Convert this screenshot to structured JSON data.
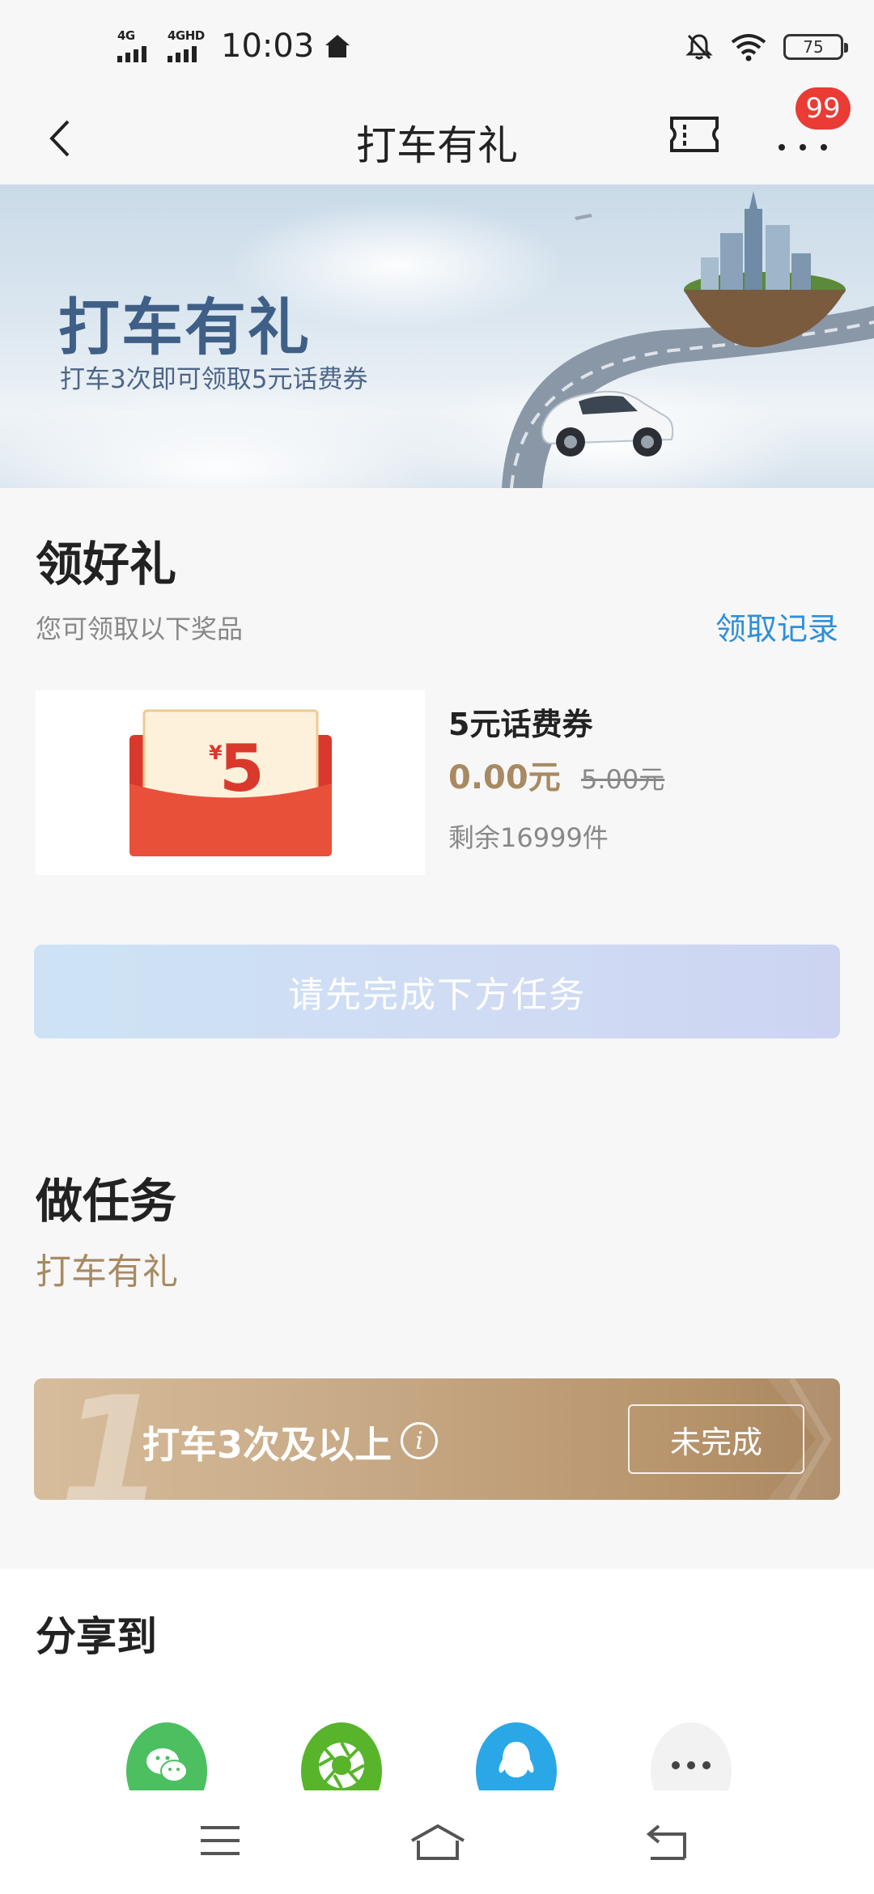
{
  "status_bar": {
    "net1": "4G",
    "net2": "4GHD",
    "time": "10:03",
    "battery": "75"
  },
  "nav": {
    "title": "打车有礼",
    "badge": "99"
  },
  "banner": {
    "title": "打车有礼",
    "subtitle": "打车3次即可领取5元话费券"
  },
  "gift": {
    "title": "领好礼",
    "subtitle": "您可领取以下奖品",
    "record_link": "领取记录",
    "prize": {
      "coupon_symbol": "¥",
      "coupon_value": "5",
      "name": "5元话费券",
      "price": "0.00元",
      "original_price": "5.00元",
      "remaining": "剩余16999件"
    },
    "claim_button": "请先完成下方任务"
  },
  "task": {
    "title": "做任务",
    "subtitle": "打车有礼",
    "item": {
      "number": "1",
      "label": "打车3次及以上",
      "info": "i",
      "status": "未完成"
    }
  },
  "share": {
    "title": "分享到",
    "targets": [
      "wechat-icon",
      "moments-icon",
      "qq-icon",
      "more-icon"
    ]
  },
  "colors": {
    "accent_gold": "#a88a62",
    "link_blue": "#2f8fd9",
    "badge_red": "#ea3b35"
  }
}
